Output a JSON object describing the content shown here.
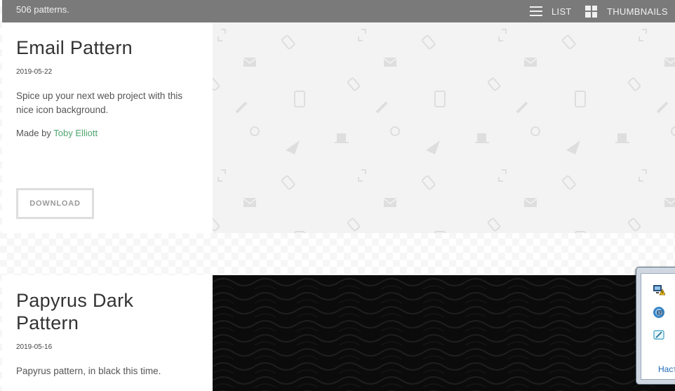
{
  "toolbar": {
    "count_text": "506 patterns.",
    "list_label": "LIST",
    "thumbnails_label": "THUMBNAILS"
  },
  "patterns": [
    {
      "title": "Email Pattern",
      "date": "2019-05-22",
      "description": "Spice up your next web project with this nice icon background.",
      "made_by_prefix": "Made by ",
      "author": "Toby Elliott",
      "download_label": "DOWNLOAD"
    },
    {
      "title": "Papyrus Dark Pattern",
      "date": "2019-05-16",
      "description": "Papyrus pattern, in black this time."
    }
  ],
  "tray": {
    "icons": [
      "network-warning-icon",
      "disk-badge-icon",
      "pen-tablet-icon"
    ],
    "link_text": "Наст"
  },
  "colors": {
    "topbar": "#7a7a7a",
    "author_link": "#4ea56e",
    "email_preview_bg": "#f3f3f3",
    "papyrus_preview_bg": "#0b0b0b"
  }
}
